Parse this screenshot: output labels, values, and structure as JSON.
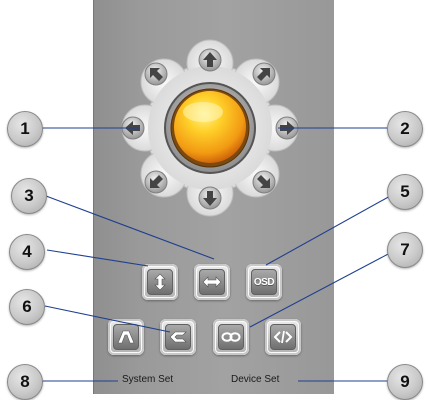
{
  "panel": {
    "captions": {
      "system_set": "System Set",
      "device_set": "Device Set"
    },
    "center_button": {
      "icon": "sun-ball-icon",
      "color": "#f4a61a"
    },
    "function_buttons": {
      "osd_label": "OSD"
    }
  },
  "callouts": [
    "1",
    "2",
    "3",
    "4",
    "5",
    "6",
    "7",
    "8",
    "9"
  ],
  "colors": {
    "panel": "#9c9c9c",
    "leader_line": "#1f3f8f",
    "center": "#f4a61a"
  }
}
